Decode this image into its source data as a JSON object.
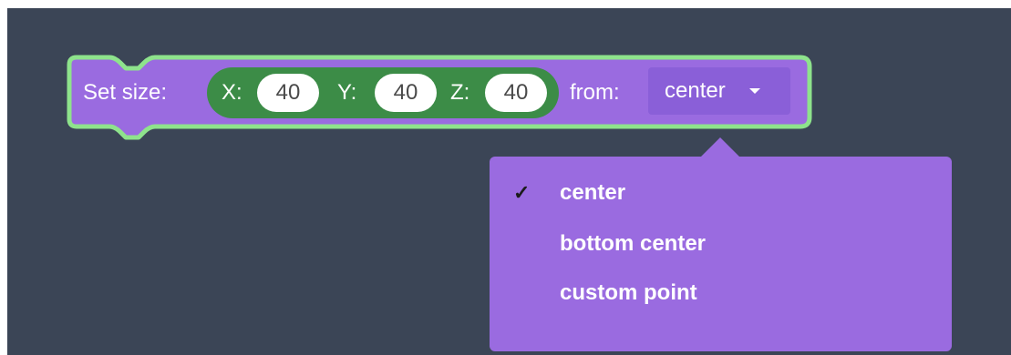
{
  "block": {
    "label": "Set size:",
    "x_label": "X:",
    "x_value": "40",
    "y_label": "Y:",
    "y_value": "40",
    "z_label": "Z:",
    "z_value": "40",
    "from_label": "from:",
    "from_value": "center"
  },
  "dropdown_menu": {
    "check_icon": "✓",
    "items": [
      {
        "label": "center",
        "selected": true
      },
      {
        "label": "bottom center",
        "selected": false
      },
      {
        "label": "custom point",
        "selected": false
      }
    ]
  },
  "colors": {
    "workspace": "#3b4556",
    "block": "#9a6be0",
    "block_outline": "#8ee38c",
    "xyz_group": "#3c8c47",
    "menu": "#9a6be0"
  }
}
